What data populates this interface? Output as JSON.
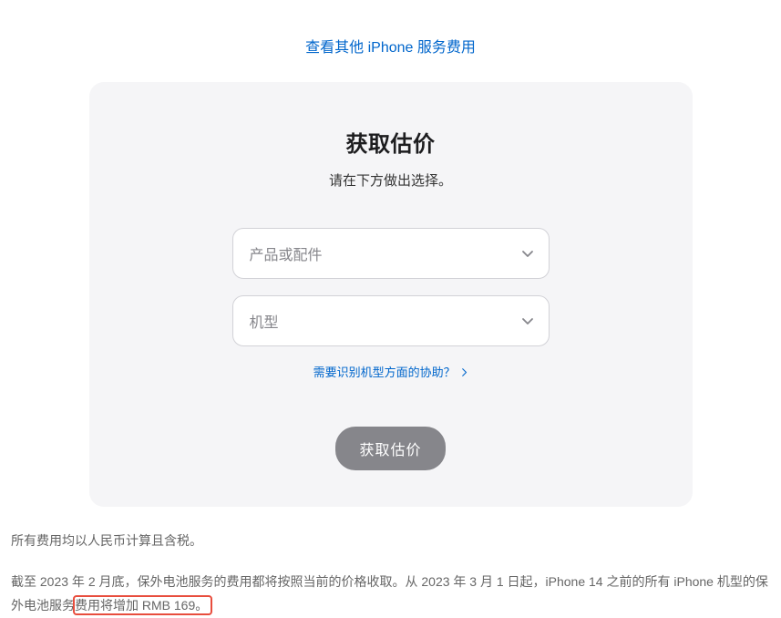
{
  "topLink": {
    "label": "查看其他 iPhone 服务费用"
  },
  "card": {
    "title": "获取估价",
    "subtitle": "请在下方做出选择。",
    "select1": {
      "placeholder": "产品或配件"
    },
    "select2": {
      "placeholder": "机型"
    },
    "helpLink": {
      "label": "需要识别机型方面的协助？"
    },
    "submitButton": {
      "label": "获取估价"
    }
  },
  "footer": {
    "line1": "所有费用均以人民币计算且含税。",
    "line2_part1": "截至 2023 年 2 月底，保外电池服务的费用都将按照当前的价格收取。从 2023 年 3 月 1 日起，iPhone 14 之前的所有 iPhone 机型的保外电池服务",
    "line2_highlight": "费用将增加 RMB 169。"
  }
}
